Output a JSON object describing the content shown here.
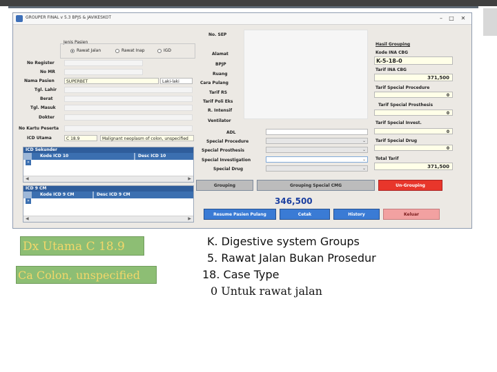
{
  "window": {
    "title": "GROUPER FINAL v 5.3 BPJS & JAVIKESKOT"
  },
  "jenis_pasien": {
    "label": "Jenis Pasien",
    "options": [
      "Rawat Jalan",
      "Rawat Inap",
      "IGD"
    ],
    "selected": "Rawat Jalan"
  },
  "left_form": {
    "no_register": "No Register",
    "no_mr": "No MR",
    "nama_pasien": "Nama Pasien",
    "nama_value": "SUPERBET",
    "jk_value": "Laki-laki",
    "tgl_lahir": "Tgl. Lahir",
    "berat": "Berat",
    "tgl_masuk": "Tgl. Masuk",
    "dokter": "Dokter",
    "no_kartu": "No Kartu Peserta",
    "icd_utama": "ICD Utama",
    "icd_code": "C 18.9",
    "icd_desc": "Malignant neoplasm of colon, unspecified"
  },
  "icd_sekunder": {
    "header": "ICD Sekunder",
    "col1": "Kode ICD 10",
    "col2": "Desc ICD 10"
  },
  "icd9": {
    "header": "ICD 9 CM",
    "col1": "Kode ICD 9 CM",
    "col2": "Desc ICD 9 CM"
  },
  "middle_form": {
    "no_sep": "No. SEP",
    "alamat": "Alamat",
    "bpjp": "BPJP",
    "ruang": "Ruang",
    "cara_pulang": "Cara Pulang",
    "tarif_rs": "Tarif RS",
    "tarif_poli": "Tarif Poli Eks",
    "r_intensif": "R. Intensif",
    "ventilator": "Ventilator",
    "adl": "ADL",
    "special_procedure": "Special Procedure",
    "special_prosthesis": "Special Prosthesis",
    "special_investigation": "Special Investigation",
    "special_drug": "Special Drug"
  },
  "hasil": {
    "header": "Hasil Grouping",
    "kode_label": "Kode INA CBG",
    "kode_value": "K-5-18-0",
    "tarif_label": "Tarif INA CBG",
    "tarif_value": "371,500",
    "proc_label": "Tarif Special Procedure",
    "proc_value": "0",
    "pros_label": "Tarif Special Prosthesis",
    "pros_value": "0",
    "inv_label": "Tarif Special Invest.",
    "inv_value": "0",
    "drug_label": "Tarif Special Drug",
    "drug_value": "0",
    "total_label": "Total Tarif",
    "total_value": "371,500"
  },
  "buttons": {
    "grouping": "Grouping",
    "grouping_special": "Grouping Special CMG",
    "ungrouping": "Un-Grouping",
    "resume": "Resume Pasien Pulang",
    "cetak": "Cetak",
    "history": "History",
    "keluar": "Keluar"
  },
  "total_display": "346,500",
  "captions": {
    "dx": "Dx Utama   C 18.9",
    "ca": "Ca   Colon, unspecified",
    "k": "K. Digestive system Groups",
    "five": "5. Rawat Jalan Bukan Prosedur",
    "eighteen": "18.   Case Type",
    "zero": "0   Untuk rawat jalan"
  },
  "colors": {
    "accent_blue": "#2f5d9b",
    "caption_bg": "#8dbe74",
    "caption_text": "#f2d76a",
    "total_blue": "#1b3fa0",
    "ungroup_red": "#e8362b"
  }
}
